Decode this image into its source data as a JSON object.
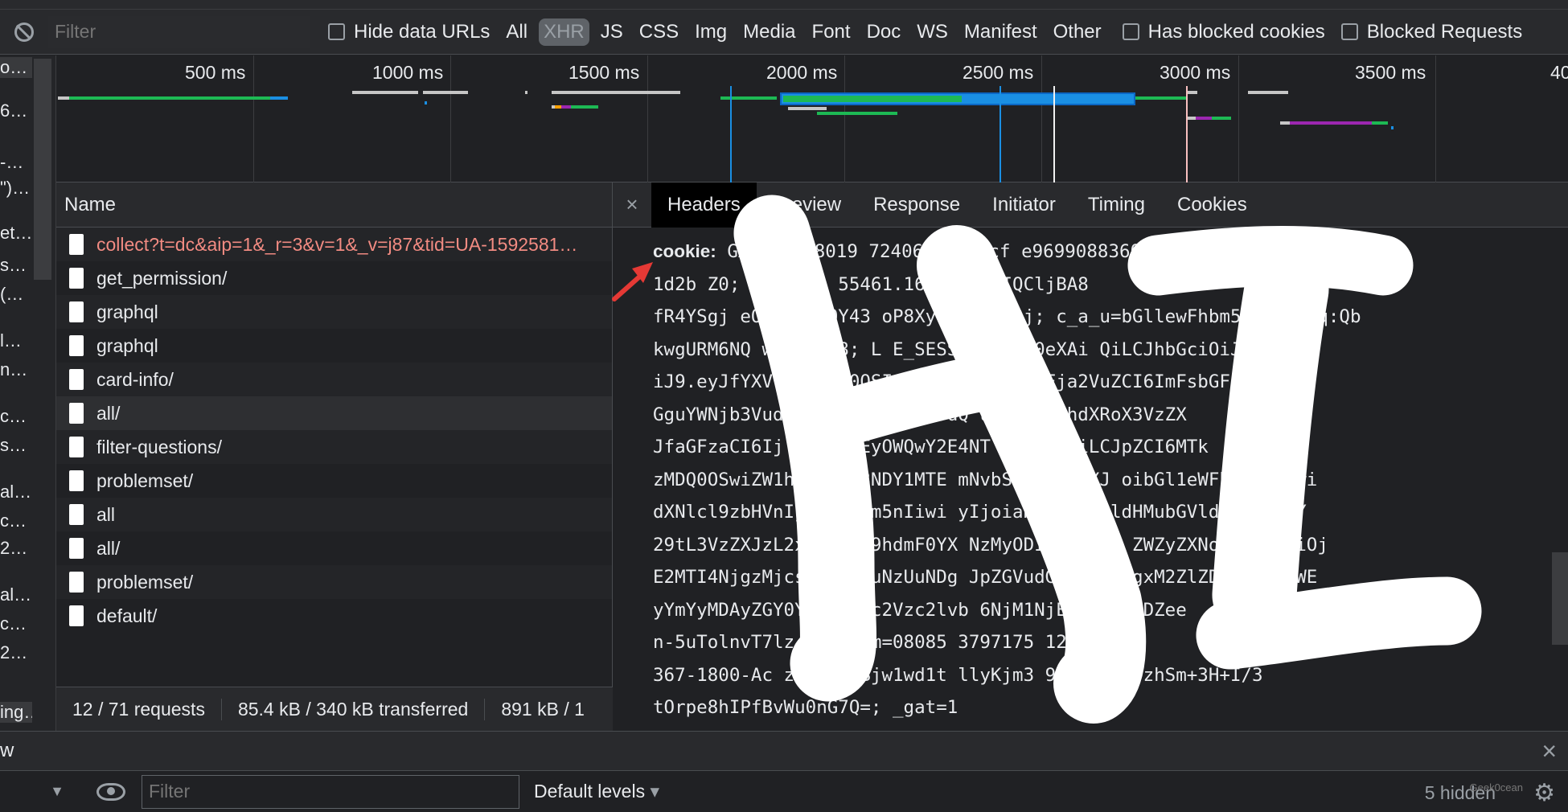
{
  "filter_bar": {
    "filter_placeholder": "Filter",
    "hide_data_urls": "Hide data URLs",
    "types": [
      "All",
      "XHR",
      "JS",
      "CSS",
      "Img",
      "Media",
      "Font",
      "Doc",
      "WS",
      "Manifest",
      "Other"
    ],
    "active_type": "XHR",
    "has_blocked_cookies": "Has blocked cookies",
    "blocked_requests": "Blocked Requests"
  },
  "left_strip": {
    "rows": [
      "o…",
      "6…",
      "-…",
      "\")…",
      "et…",
      "s…",
      "(…",
      "l…",
      "n…",
      "c…",
      "s…",
      "al…",
      "c…",
      "2…",
      "al…",
      "c…",
      "2…",
      "ing…"
    ]
  },
  "timeline": {
    "ticks": [
      "500 ms",
      "1000 ms",
      "1500 ms",
      "2000 ms",
      "2500 ms",
      "3000 ms",
      "3500 ms",
      "40"
    ]
  },
  "request_list": {
    "header": "Name",
    "rows": [
      "collect?t=dc&aip=1&_r=3&v=1&_v=j87&tid=UA-1592581…",
      "get_permission/",
      "graphql",
      "graphql",
      "card-info/",
      "all/",
      "filter-questions/",
      "problemset/",
      "all",
      "all/",
      "problemset/",
      "default/"
    ],
    "footer": {
      "requests": "12 / 71 requests",
      "transferred": "85.4 kB / 340 kB transferred",
      "resources": "891 kB / 1"
    }
  },
  "details": {
    "close": "×",
    "tabs": [
      "Headers",
      "Preview",
      "Response",
      "Initiator",
      "Timing",
      "Cookies"
    ],
    "active_tab": "Headers",
    "cookie_label": "cookie:",
    "cookie_lines": [
      "  GA1.2.308019      7240669; __cf                 e9699088360add",
      "1d2b       Z0; _gid=GA        55461.1612                 mWKMIQCljBA8",
      "fR4YSgj      eOkXURxZOY43     oP8XycbeoXDN2j; c_a_u=bGllewFhbm5n:1l9Ubq:Qb",
      "kwgURM6NQ       wHistb58; L        E_SESSION=eyJ0eXAi       QiLCJhbGciOiJIUzI1N",
      "iJ9.eyJfYXV      VyX2l    0OSIsIl9hdXRoX3Vz      Fja2VuZCI6ImFsbGF1d",
      "GguYWNjb3Vud       GhlbnRpY2F0aW9uQ      uZCIsIl9hdXRoX3VzZX",
      "JfaGFzaCI6Ij       dlZ     NTEyOWQwY2E4NT       NGYwZjIiLCJpZCI6MTk",
      "zMDQ0OSwiZW1ha      xNzU3NDY1MTE     mNvbSIsInVzZXJ      oibGl1eWFhbm5nIiwi",
      "dXNlcl9zbHVnIj       eWFhbm5nIiwi     yIjoiaHR0cHM6       ldHMubGVldGNvZGUuY",
      "29tL3VzZXJzL2xp      5uZy9hdmF0YX     NzMyODI1NS5wbm      ZWZyZXNoZWRfYXQiOj",
      "E2MTI4NjgzMjcsI      iMTMuNzUuNDg     JpZGVudGl0eSI       jgxM2ZlZDNhMWI3NWE",
      "yYmYyMDAyZGY0Yz      Iiwic2Vzc2lvb    6NjM1NjEyM30       CbDZee",
      "n-5uTolnvT7lz      __cf_bm=08085       3797175              12967",
      "367-1800-Ac       zqFAeWqBjw1wd1t      llyKjm3        99yph0GdOzhSm+3H+I/3",
      "tOrpe8hIPfBvWu0nG7Q=; _gat=1"
    ],
    "overlay_text": "HI"
  },
  "console": {
    "drawer_title": "w",
    "close": "×",
    "context_caret": "▼",
    "filter_placeholder": "Filter",
    "levels": "Default levels",
    "hidden": "5 hidden"
  },
  "watermark": "Geek0cean"
}
